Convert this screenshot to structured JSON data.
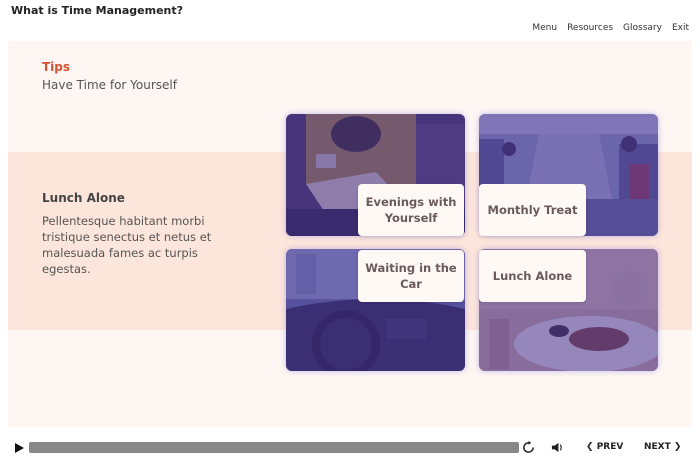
{
  "course": {
    "title": "What is Time Management?"
  },
  "nav": {
    "menu": "Menu",
    "resources": "Resources",
    "glossary": "Glossary",
    "exit": "Exit"
  },
  "tips": {
    "label": "Tips",
    "subtitle": "Have Time for Yourself"
  },
  "detail": {
    "title": "Lunch Alone",
    "body": "Pellentesque habitant morbi tristique senectus et netus et malesuada fames ac turpis egestas."
  },
  "tiles": {
    "evenings": "Evenings with Yourself",
    "monthly": "Monthly Treat",
    "waiting": "Waiting in the Car",
    "lunch": "Lunch Alone"
  },
  "player": {
    "prev": "PREV",
    "next": "NEXT"
  },
  "colors": {
    "accent": "#d3522f",
    "band": "#fce5da",
    "slide_bg": "#fdf6f2",
    "tile_tint": "#46328f"
  }
}
